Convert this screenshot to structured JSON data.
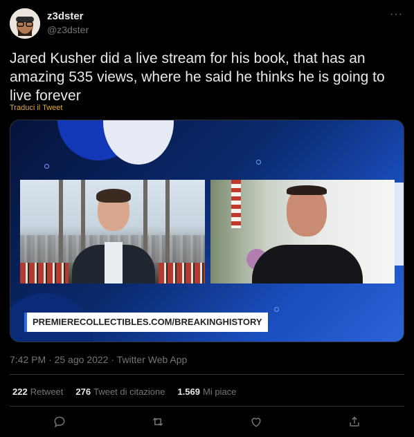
{
  "tweet": {
    "display_name": "z3dster",
    "handle": "@z3dster",
    "more_icon": "more-horizontal-icon",
    "text": "Jared Kusher did a live stream for his book, that has an amazing 535 views, where he said he thinks he is going to live forever",
    "translate_label": "Traduci il Tweet",
    "media": {
      "banner_text": "PREMIERECOLLECTIBLES.COM/BREAKINGHISTORY"
    },
    "meta": "7:42 PM · 25 ago 2022 · Twitter Web App",
    "stats": {
      "retweets_count": "222",
      "retweets_label": "Retweet",
      "quotes_count": "276",
      "quotes_label": "Tweet di citazione",
      "likes_count": "1.569",
      "likes_label": "Mi piace"
    },
    "actions": [
      "reply-icon",
      "retweet-icon",
      "like-icon",
      "share-icon"
    ]
  },
  "colors": {
    "background": "#000000",
    "text": "#e7e9ea",
    "muted": "#71767b",
    "translate_link": "#e5a93a",
    "divider": "#2f3336"
  }
}
